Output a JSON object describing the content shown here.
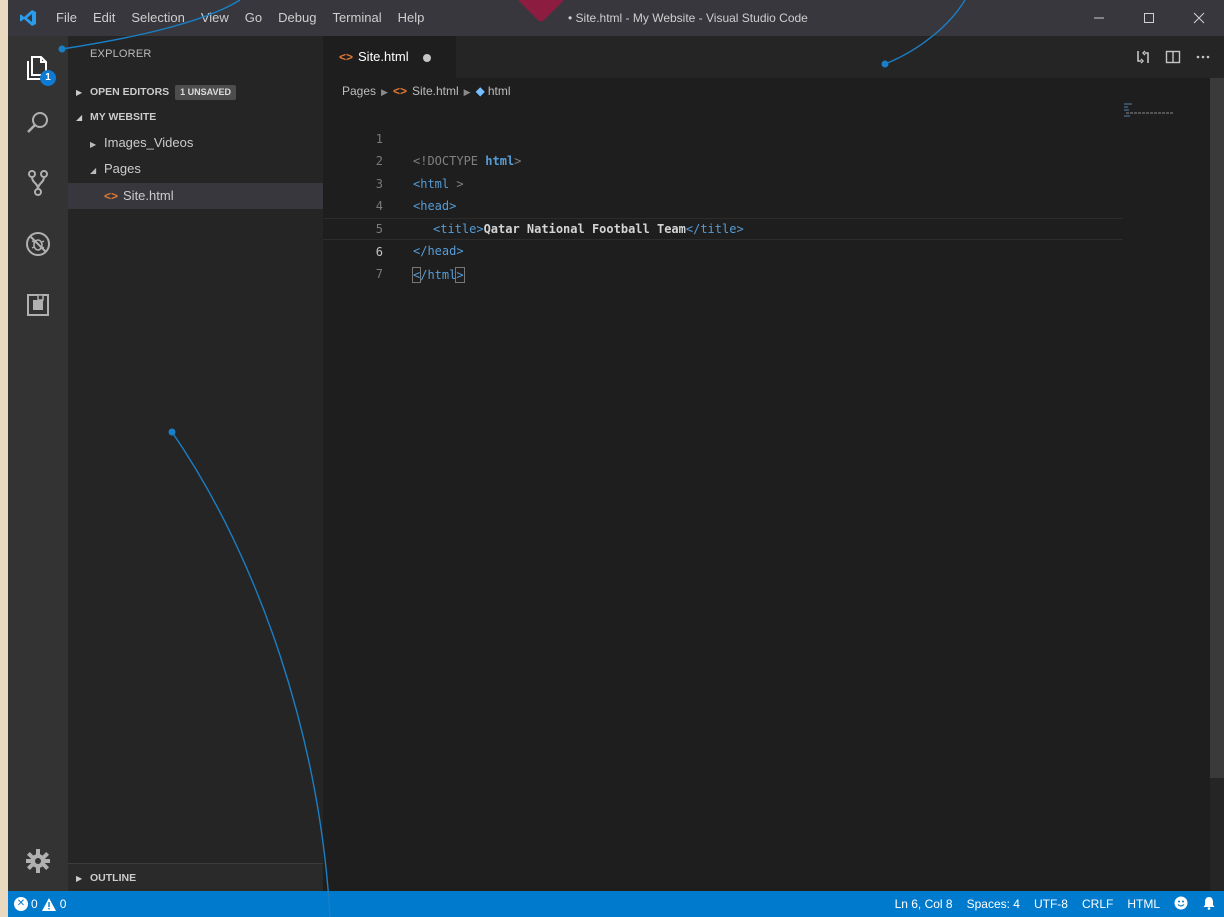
{
  "titlebar": {
    "menu": [
      "File",
      "Edit",
      "Selection",
      "View",
      "Go",
      "Debug",
      "Terminal",
      "Help"
    ],
    "title": "• Site.html - My Website - Visual Studio Code",
    "controls": {
      "minimize": "—",
      "maximize": "☐",
      "close": "✕"
    }
  },
  "activity": {
    "files_badge": "1",
    "icons": [
      "files-icon",
      "search-icon",
      "source-control-icon",
      "debug-icon",
      "extensions-icon",
      "settings-gear-icon"
    ]
  },
  "sidebar": {
    "title": "EXPLORER",
    "open_editors": {
      "label": "OPEN EDITORS",
      "badge": "1 UNSAVED"
    },
    "workspace": {
      "label": "MY WEBSITE"
    },
    "items": [
      {
        "label": "Images_Videos",
        "expanded": false
      },
      {
        "label": "Pages",
        "expanded": true
      },
      {
        "label": "Site.html",
        "type": "html",
        "selected": true
      }
    ],
    "outline": {
      "label": "OUTLINE"
    }
  },
  "editor": {
    "tab": {
      "label": "Site.html",
      "dirty": true
    },
    "breadcrumbs": [
      "Pages",
      "Site.html",
      "html"
    ],
    "lines": [
      {
        "num": "1"
      },
      {
        "num": "2"
      },
      {
        "num": "3"
      },
      {
        "num": "4"
      },
      {
        "num": "5"
      },
      {
        "num": "6",
        "active": true
      },
      {
        "num": "7"
      }
    ],
    "code": {
      "l1_doctype": "<!DOCTYPE",
      "l1_html": "html",
      "l1_close": ">",
      "l2_open": "<html",
      "l2_close": " >",
      "l3": "<head>",
      "l4_open": "<title>",
      "l4_text": "Qatar National Football Team",
      "l4_close": "</title>",
      "l5": "</head>",
      "l6_lt": "<",
      "l6_body": "/html",
      "l6_gt": ">"
    }
  },
  "statusbar": {
    "errors": "0",
    "warnings": "0",
    "position": "Ln 6, Col 8",
    "spaces": "Spaces: 4",
    "encoding": "UTF-8",
    "eol": "CRLF",
    "language": "HTML"
  },
  "colors": {
    "accent": "#007acc",
    "background": "#1e1e1e",
    "sidebar": "#252526",
    "activity": "#333333",
    "callout": "#1a7fc4",
    "heart": "#8c1d40"
  }
}
